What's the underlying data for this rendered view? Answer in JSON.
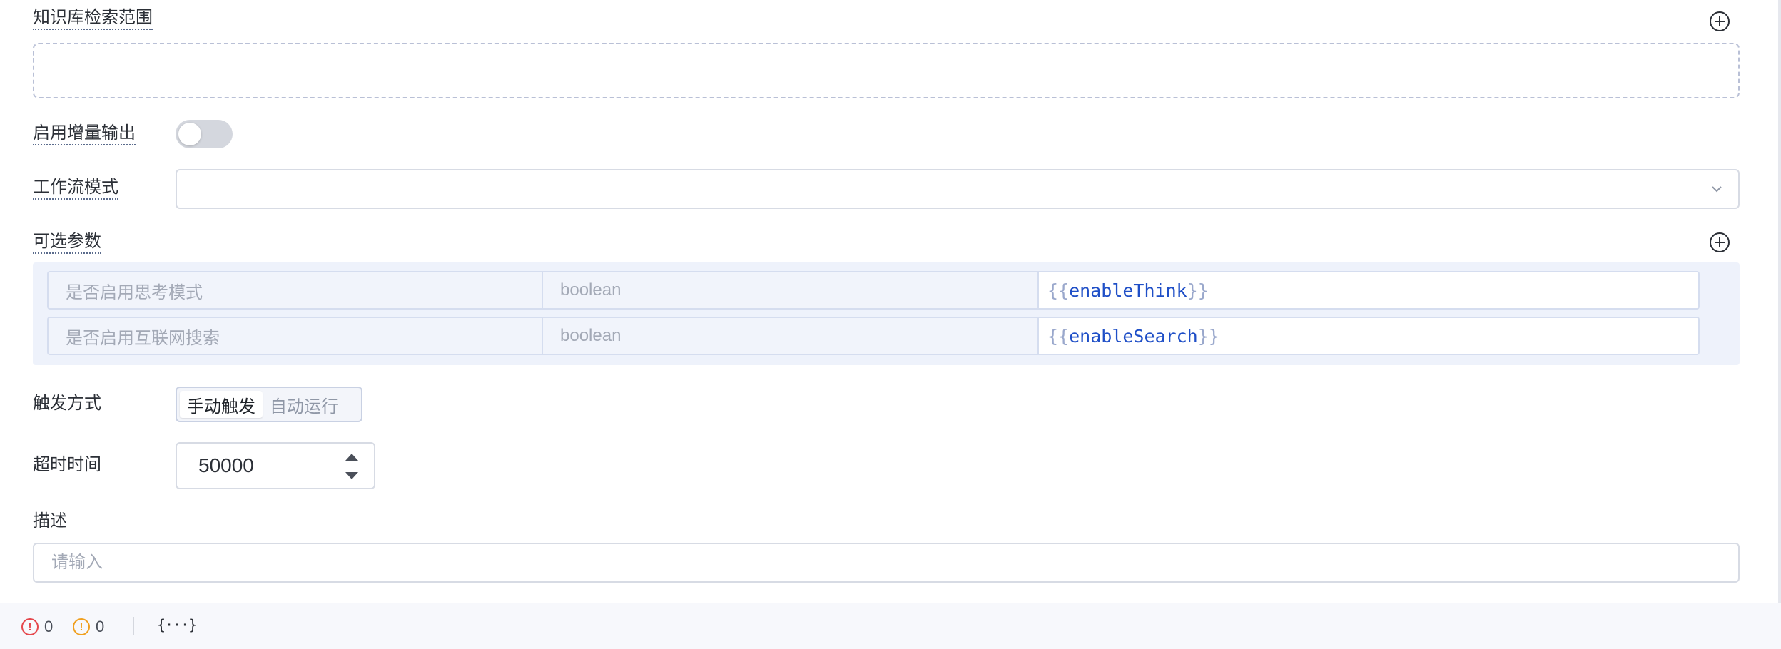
{
  "knowledge_base": {
    "label": "知识库检索范围",
    "add_icon": "plus-circle-icon"
  },
  "incremental_output": {
    "label": "启用增量输出",
    "enabled": false
  },
  "workflow_mode": {
    "label": "工作流模式",
    "value": "",
    "chevron_icon": "chevron-down-icon"
  },
  "optional_params": {
    "label": "可选参数",
    "add_icon": "plus-circle-icon",
    "rows": [
      {
        "name": "是否启用思考模式",
        "type": "boolean",
        "value_open": "{{",
        "value_var": "enableThink",
        "value_close": "}}"
      },
      {
        "name": "是否启用互联网搜索",
        "type": "boolean",
        "value_open": "{{",
        "value_var": "enableSearch",
        "value_close": "}}"
      }
    ]
  },
  "trigger": {
    "label": "触发方式",
    "options": [
      "手动触发",
      "自动运行"
    ],
    "selected": "手动触发"
  },
  "timeout": {
    "label": "超时时间",
    "value": "50000"
  },
  "description": {
    "label": "描述",
    "placeholder": "请输入"
  },
  "status_bar": {
    "error_count": "0",
    "warning_count": "0",
    "error_icon": "error-circle-icon",
    "warning_icon": "warning-circle-icon",
    "variables_icon": "variables-braces-icon",
    "variables_glyph": "{···}"
  },
  "colors": {
    "accent_text": "#1f4fc7",
    "error": "#e5484d",
    "warning": "#f0a020",
    "panel_bg": "#eef2fb"
  }
}
